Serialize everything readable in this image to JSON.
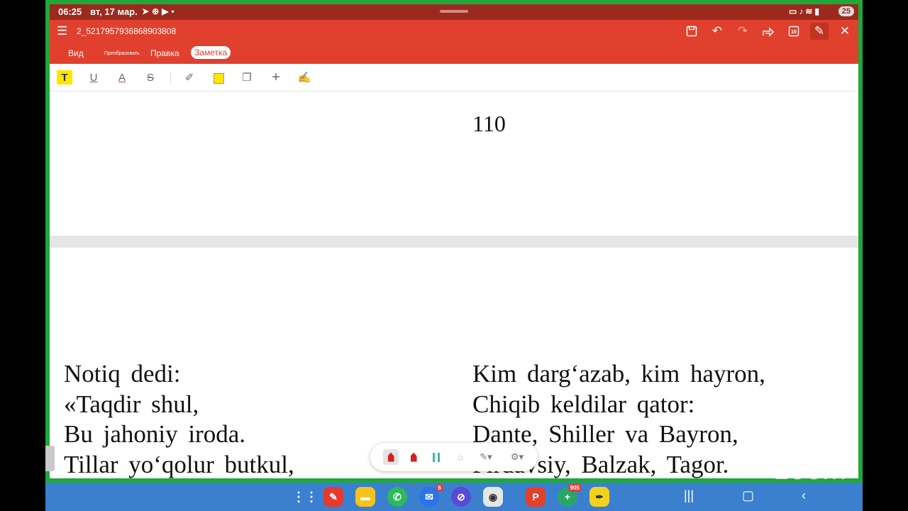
{
  "status_bar": {
    "time": "06:25",
    "date": "вт, 17 мар.",
    "battery": "25"
  },
  "titlebar": {
    "filename": "2_5217957936868903808"
  },
  "tabs": [
    {
      "label": "Вид"
    },
    {
      "label": "Преобразовать"
    },
    {
      "label": "Правка"
    },
    {
      "label": "Заметка"
    }
  ],
  "document": {
    "page_number": "110",
    "left_column": [
      "Notiq dedi:",
      "«Taqdir shul,",
      "Bu jahoniy iroda.",
      "Tillar yo‘qolur butkul,"
    ],
    "right_column": [
      "Kim darg‘azab, kim hayron,",
      "Chiqib keldilar qator:",
      "Dante, Shiller va Bayron,",
      "Firdavsiy, Balzak, Tagor."
    ]
  },
  "taskbar": {
    "messages_badge": "6",
    "plus_badge": "905"
  },
  "watermark": "zoom",
  "colors": {
    "accent": "#e0402d",
    "status_bar": "#9b2a1e",
    "frame": "#1fa83a",
    "taskbar": "#3b80cf"
  }
}
